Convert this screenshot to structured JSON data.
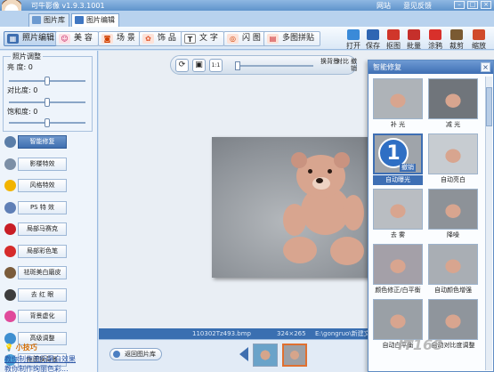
{
  "titlebar": {
    "app_title": "可牛影像 v1.9.3.1001",
    "links": [
      "网站",
      "意见反馈"
    ],
    "minimize": "–",
    "maximize": "□",
    "close": "×"
  },
  "module_tabs": [
    {
      "label": "图片库",
      "icon": "folder-icon"
    },
    {
      "label": "图片编辑",
      "icon": "picture-edit-icon",
      "active": true
    }
  ],
  "toolbar": {
    "buttons": [
      {
        "label": "照片编辑",
        "icon": "photo-edit-icon",
        "active": true
      },
      {
        "label": "美 容",
        "icon": "beauty-icon"
      },
      {
        "label": "场 景",
        "icon": "scene-icon"
      },
      {
        "label": "饰 品",
        "icon": "accessory-icon"
      },
      {
        "label": "文 字",
        "icon": "text-icon"
      },
      {
        "label": "闪 图",
        "icon": "flash-icon"
      },
      {
        "label": "多图拼贴",
        "icon": "collage-icon"
      }
    ],
    "right_tools": [
      {
        "label": "打开",
        "icon": "open-icon"
      },
      {
        "label": "保存",
        "icon": "save-icon"
      },
      {
        "label": "抠图",
        "icon": "cutout-icon"
      },
      {
        "label": "批量",
        "icon": "batch-icon"
      },
      {
        "label": "涂鸦",
        "icon": "doodle-icon"
      },
      {
        "label": "裁剪",
        "icon": "crop-icon"
      },
      {
        "label": "缩放",
        "icon": "resize-icon"
      }
    ]
  },
  "adjust": {
    "group_title": "照片调整",
    "sliders": [
      {
        "label": "亮  度",
        "value": "0",
        "level": 0.5
      },
      {
        "label": "对比度",
        "value": "0",
        "level": 0.5
      },
      {
        "label": "饱和度",
        "value": "0",
        "level": 0.5
      }
    ]
  },
  "left_buttons": [
    {
      "label": "智能修复",
      "icon": "smart-repair-icon",
      "color": "#5b7ea8",
      "active": true
    },
    {
      "label": "影楼特效",
      "icon": "studio-effect-icon",
      "color": "#7c8fa6"
    },
    {
      "label": "风格特效",
      "icon": "style-effect-icon",
      "color": "#f2b400"
    },
    {
      "label": "PS 特 效",
      "icon": "ps-effect-icon",
      "color": "#5f7fb6"
    },
    {
      "label": "局部马赛克",
      "icon": "mosaic-icon",
      "color": "#c81d25"
    },
    {
      "label": "局部彩色笔",
      "icon": "color-pen-icon",
      "color": "#d62b2b"
    },
    {
      "label": "祛斑美白磨皮",
      "icon": "skin-smooth-icon",
      "color": "#7b5c3b"
    },
    {
      "label": "去 红 眼",
      "icon": "red-eye-icon",
      "color": "#3d3d3d"
    },
    {
      "label": "背景虚化",
      "icon": "blur-background-icon",
      "color": "#e04a9b"
    },
    {
      "label": "高级调整",
      "icon": "advanced-adjust-icon",
      "color": "#3f8fd0"
    },
    {
      "label": "抠图换背景",
      "icon": "change-background-icon",
      "color": "#4aa0d8"
    }
  ],
  "tips": {
    "title": "小技巧",
    "links": [
      "教你制作流行黑白效果",
      "教你制作绚丽色彩..."
    ]
  },
  "viewbar": {
    "rotate": "⟳",
    "fit": "▣",
    "actual": "1:1",
    "zoom_level": 0.0,
    "labels": [
      "换背景",
      "对比",
      "撤销",
      "重做"
    ]
  },
  "status": {
    "filename": "110302Tz493.bmp",
    "dimensions": "324×265",
    "path": "E:\\gongruo\\新建文件夹..."
  },
  "thumbstrip": {
    "back_label": "返回图片库"
  },
  "smart_panel": {
    "title": "智能修复",
    "close": "×",
    "items": [
      {
        "caption": "补  光"
      },
      {
        "caption": "减  光"
      },
      {
        "caption": "自动曝光",
        "selected": true,
        "badge": "1",
        "badge_text": "撤销"
      },
      {
        "caption": "自动亮白"
      },
      {
        "caption": "去  雾"
      },
      {
        "caption": "降噪"
      },
      {
        "caption": "颜色修正/白平衡"
      },
      {
        "caption": "自动颜色增强"
      },
      {
        "caption": "自动白平衡"
      },
      {
        "caption": "自动对比度调整"
      }
    ]
  },
  "watermark": "IT168"
}
